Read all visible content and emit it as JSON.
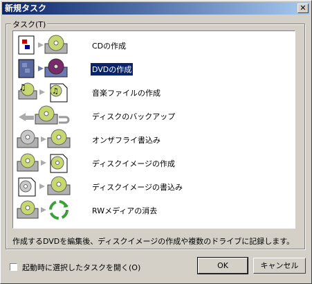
{
  "window": {
    "title": "新規タスク"
  },
  "group": {
    "label": "タスク(T)"
  },
  "tasks": [
    {
      "label": "CDの作成",
      "icon": "cd-write-icon",
      "selected": false
    },
    {
      "label": "DVDの作成",
      "icon": "dvd-write-icon",
      "selected": true
    },
    {
      "label": "音楽ファイルの作成",
      "icon": "music-file-icon",
      "selected": false
    },
    {
      "label": "ディスクのバックアップ",
      "icon": "disc-backup-icon",
      "selected": false
    },
    {
      "label": "オンザフライ書込み",
      "icon": "on-the-fly-icon",
      "selected": false
    },
    {
      "label": "ディスクイメージの作成",
      "icon": "disc-image-create-icon",
      "selected": false
    },
    {
      "label": "ディスクイメージの書込み",
      "icon": "disc-image-write-icon",
      "selected": false
    },
    {
      "label": "RWメディアの消去",
      "icon": "rw-erase-icon",
      "selected": false
    }
  ],
  "description": "作成するDVDを編集後、ディスクイメージの作成や複数のドライブに記録します。",
  "startup_checkbox": {
    "label": "起動時に選択したタスクを開く(O)",
    "checked": false
  },
  "buttons": {
    "ok": "OK",
    "cancel": "キャンセル"
  },
  "colors": {
    "title_start": "#0a246a",
    "title_end": "#a6caf0",
    "selection": "#0a246a",
    "face": "#d4d0c8"
  }
}
